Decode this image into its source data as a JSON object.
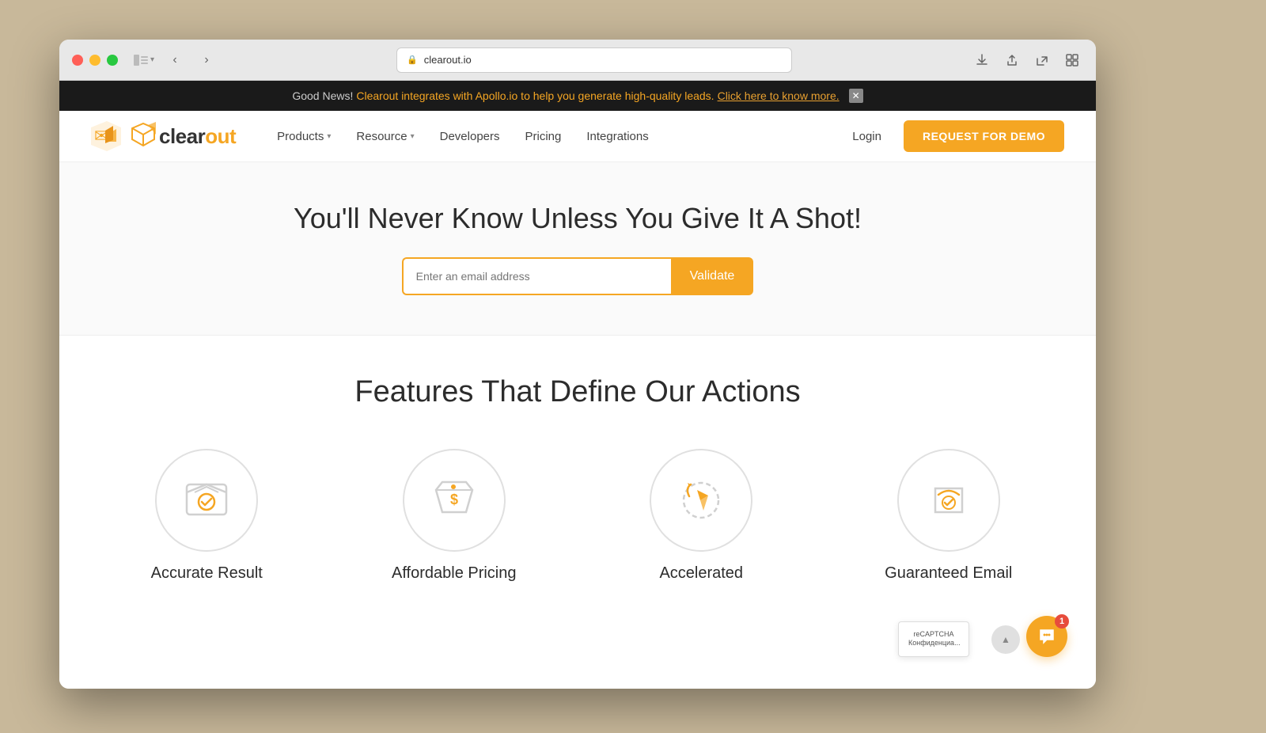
{
  "browser": {
    "url": "clearout.io",
    "back_btn": "‹",
    "forward_btn": "›"
  },
  "banner": {
    "prefix": "Good News!",
    "highlight": " Clearout integrates with Apollo.io to help you generate high-quality leads.",
    "link_text": " Click here to know more.",
    "close_label": "✕"
  },
  "navbar": {
    "logo_text": "clearout",
    "products_label": "Products",
    "resource_label": "Resource",
    "developers_label": "Developers",
    "pricing_label": "Pricing",
    "integrations_label": "Integrations",
    "login_label": "Login",
    "demo_label": "REQUEST FOR DEMO"
  },
  "hero": {
    "title": "You'll Never Know Unless You Give It A Shot!",
    "input_placeholder": "Enter an email address",
    "validate_label": "Validate"
  },
  "features": {
    "section_title": "Features That Define Our Actions",
    "items": [
      {
        "id": "accurate-result",
        "label": "Accurate Result"
      },
      {
        "id": "affordable-pricing",
        "label": "Affordable Pricing"
      },
      {
        "id": "accelerated",
        "label": "Accelerated"
      },
      {
        "id": "guaranteed-email",
        "label": "Guaranteed Email"
      }
    ]
  },
  "chat": {
    "badge": "1",
    "scroll_up": "▲"
  },
  "colors": {
    "accent": "#f5a623",
    "dark": "#2c2c2c",
    "border": "#e0e0e0"
  }
}
